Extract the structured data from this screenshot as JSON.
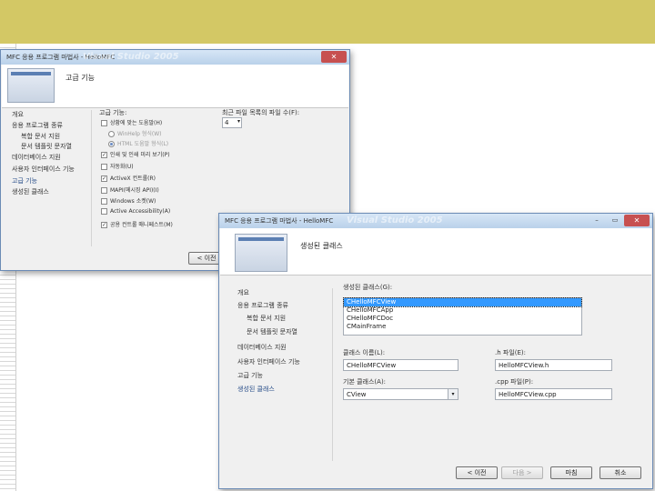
{
  "back_window": {
    "title": "MFC 응용 프로그램 마법사 - HelloMFC",
    "watermark": "Visual Studio 2005",
    "header_title": "고급 기능",
    "nav": [
      "개요",
      "응용 프로그램 종류",
      "복합 문서 지원",
      "문서 템플릿 문자열",
      "데이터베이스 지원",
      "사용자 인터페이스 기능",
      "고급 기능",
      "생성된 클래스"
    ],
    "section_label": "고급 기능:",
    "options": [
      {
        "label": "상황에 맞는 도움말(H)",
        "checked": false,
        "type": "checkbox"
      },
      {
        "label": "WinHelp 형식(W)",
        "checked": false,
        "type": "radio"
      },
      {
        "label": "HTML 도움말 형식(L)",
        "checked": true,
        "type": "radio"
      },
      {
        "label": "인쇄 및 인쇄 미리 보기(P)",
        "checked": true,
        "type": "checkbox"
      },
      {
        "label": "자동화(U)",
        "checked": false,
        "type": "checkbox"
      },
      {
        "label": "ActiveX 컨트롤(R)",
        "checked": true,
        "type": "checkbox"
      },
      {
        "label": "MAPI(메시징 API)(I)",
        "checked": false,
        "type": "checkbox"
      },
      {
        "label": "Windows 소켓(W)",
        "checked": false,
        "type": "checkbox"
      },
      {
        "label": "Active Accessibility(A)",
        "checked": false,
        "type": "checkbox"
      },
      {
        "label": "공용 컨트롤 매니페스트(M)",
        "checked": true,
        "type": "checkbox"
      }
    ],
    "mru_label": "최근 파일 목록의 파일 수(F):",
    "mru_value": "4",
    "back_button": "< 이전"
  },
  "front_window": {
    "title": "MFC 응용 프로그램 마법사 - HelloMFC",
    "watermark": "Visual Studio 2005",
    "header_title": "생성된 클래스",
    "nav": [
      "개요",
      "응용 프로그램 종류",
      "복합 문서 지원",
      "문서 템플릿 문자열",
      "데이터베이스 지원",
      "사용자 인터페이스 기능",
      "고급 기능",
      "생성된 클래스"
    ],
    "classes_label": "생성된 클래스(G):",
    "classes": [
      "CHelloMFCView",
      "CHelloMFCApp",
      "CHelloMFCDoc",
      "CMainFrame"
    ],
    "selected_class_index": 0,
    "class_name_label": "클래스 이름(L):",
    "class_name_value": "CHelloMFCView",
    "h_file_label": ".h 파일(E):",
    "h_file_value": "HelloMFCView.h",
    "base_class_label": "기본 클래스(A):",
    "base_class_value": "CView",
    "cpp_file_label": ".cpp 파일(P):",
    "cpp_file_value": "HelloMFCView.cpp",
    "buttons": {
      "back": "< 이전",
      "next": "다음 >",
      "finish": "마침",
      "cancel": "취소"
    }
  },
  "colors": {
    "top_band": "#d3c865",
    "selection": "#3399ff",
    "close_button": "#c75050"
  }
}
